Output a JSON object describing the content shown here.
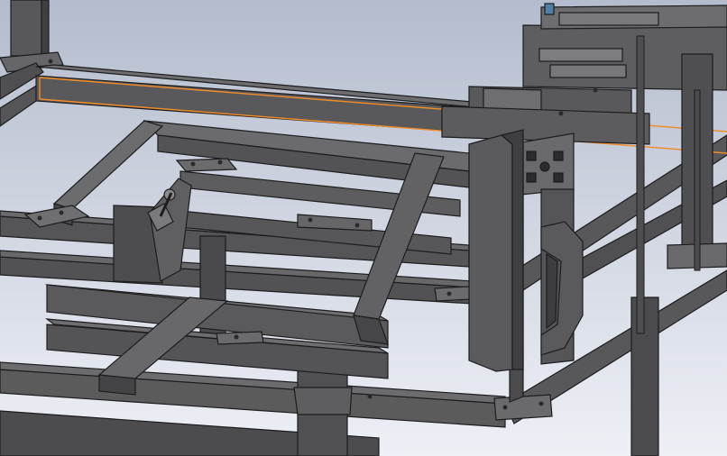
{
  "viewport": {
    "background_top": "#b4bccd",
    "background_bottom": "#eef0f6",
    "part_face": "#5b5b5c",
    "part_face_light": "#6c6c6e",
    "part_face_dark": "#3f3f41",
    "part_edge": "#1d1d1f",
    "selection_highlight": "#f28c28",
    "blue_accent": "#4f7fa8"
  },
  "model": {
    "view": "isometric",
    "selected_member": "upper-horizontal-rail",
    "components": [
      {
        "name": "upper-horizontal-rail",
        "state": "selected"
      },
      {
        "name": "inner-rectangular-frame"
      },
      {
        "name": "lower-frame"
      },
      {
        "name": "top-right-actuator-assembly"
      },
      {
        "name": "vertical-guide-plate"
      },
      {
        "name": "aluminum-extrusion-profile"
      },
      {
        "name": "bracket-hook"
      },
      {
        "name": "clamp-lever"
      }
    ]
  }
}
